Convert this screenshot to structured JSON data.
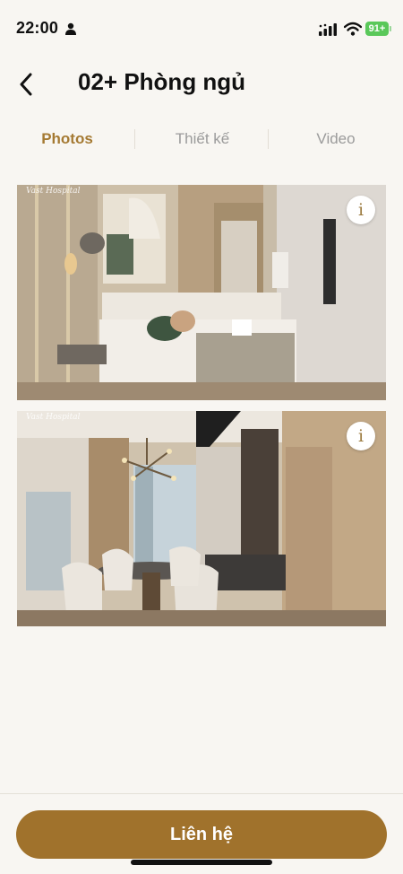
{
  "status_bar": {
    "time": "22:00",
    "battery": "91+",
    "icons": [
      "person-icon",
      "signal-icon",
      "wifi-icon",
      "battery-icon"
    ]
  },
  "header": {
    "title": "02+ Phòng ngủ",
    "back_icon": "chevron-left-icon"
  },
  "tabs": [
    {
      "label": "Photos",
      "active": true
    },
    {
      "label": "Thiết kế",
      "active": false
    },
    {
      "label": "Video",
      "active": false
    }
  ],
  "photos": [
    {
      "subject": "bedroom",
      "info_label": "i",
      "watermark": "Vast Hospital"
    },
    {
      "subject": "dining-living-room",
      "info_label": "i",
      "watermark": "Vast Hospital"
    }
  ],
  "footer": {
    "contact_label": "Liên hệ"
  },
  "colors": {
    "accent": "#a57a33",
    "button": "#a0722c",
    "background": "#f8f6f2",
    "battery": "#5ac85a"
  }
}
